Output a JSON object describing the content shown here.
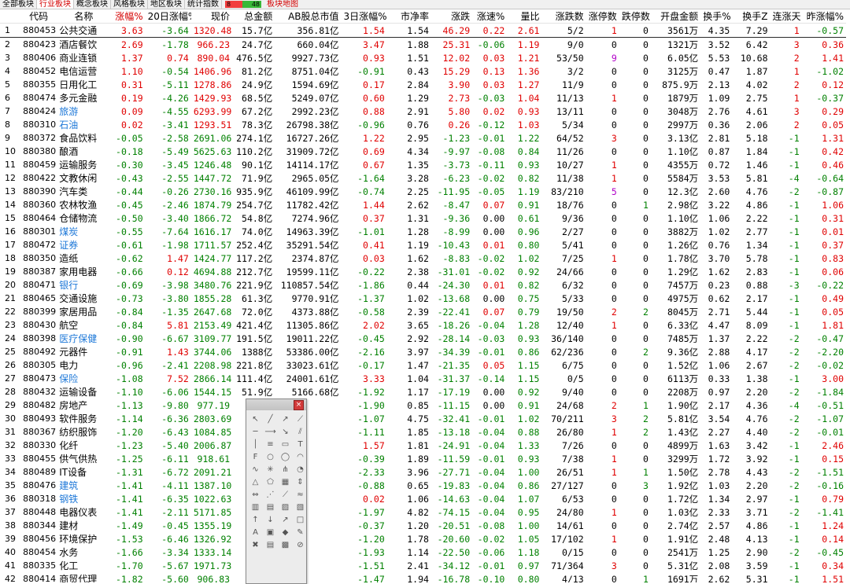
{
  "tabs": [
    {
      "label": "全部板块",
      "active": false
    },
    {
      "label": "行业板块",
      "active": true
    },
    {
      "label": "概念板块",
      "active": false
    },
    {
      "label": "风格板块",
      "active": false
    },
    {
      "label": "地区板块",
      "active": false
    },
    {
      "label": "统计指数",
      "active": false
    }
  ],
  "breadth": {
    "advancing": "8",
    "declining": "48"
  },
  "map_tab_label": "板块地图",
  "columns": [
    "",
    "代码",
    "名称",
    "涨幅%",
    "20日涨幅%",
    "现价",
    "总金额",
    "AB股总市值",
    "3日涨幅%",
    "市净率",
    "涨跌",
    "涨速%",
    "量比",
    "涨跌数",
    "涨停数",
    "跌停数",
    "开盘金额",
    "换手%",
    "换手Z",
    "连涨天",
    "昨涨幅%"
  ],
  "sorted_column": "涨幅%",
  "rows": [
    [
      "1",
      "880453",
      "公共交通",
      "3.63",
      "-3.64",
      "1320.48",
      "15.7亿",
      "356.81亿",
      "1.54",
      "1.54",
      "46.29",
      "0.22",
      "2.61",
      "5/2",
      "1",
      "0",
      "3561万",
      "4.35",
      "7.29",
      "1",
      "-0.57"
    ],
    [
      "2",
      "880423",
      "酒店餐饮",
      "2.69",
      "-1.78",
      "966.23",
      "24.7亿",
      "660.04亿",
      "3.47",
      "1.88",
      "25.31",
      "-0.06",
      "1.19",
      "9/0",
      "0",
      "0",
      "1321万",
      "3.52",
      "6.42",
      "3",
      "0.36"
    ],
    [
      "3",
      "880406",
      "商业连锁",
      "1.37",
      "0.74",
      "890.04",
      "476.5亿",
      "9927.73亿",
      "0.93",
      "1.51",
      "12.02",
      "0.03",
      "1.21",
      "53/50",
      "9",
      "0",
      "6.05亿",
      "5.53",
      "10.68",
      "2",
      "1.41"
    ],
    [
      "4",
      "880452",
      "电信运营",
      "1.10",
      "-0.54",
      "1406.96",
      "81.2亿",
      "8751.04亿",
      "-0.91",
      "0.43",
      "15.29",
      "0.13",
      "1.36",
      "3/2",
      "0",
      "0",
      "3125万",
      "0.47",
      "1.87",
      "1",
      "-1.02"
    ],
    [
      "5",
      "880355",
      "日用化工",
      "0.31",
      "-5.11",
      "1278.86",
      "24.9亿",
      "1594.69亿",
      "0.17",
      "2.84",
      "3.90",
      "0.03",
      "1.27",
      "11/9",
      "0",
      "0",
      "875.9万",
      "2.13",
      "4.02",
      "2",
      "0.12"
    ],
    [
      "6",
      "880474",
      "多元金融",
      "0.19",
      "-4.26",
      "1429.93",
      "68.5亿",
      "5249.07亿",
      "0.60",
      "1.29",
      "2.73",
      "-0.03",
      "1.04",
      "11/13",
      "1",
      "0",
      "1879万",
      "1.09",
      "2.75",
      "1",
      "-0.37"
    ],
    [
      "7",
      "880424",
      "旅游",
      "0.09",
      "-4.55",
      "6293.99",
      "67.2亿",
      "2992.23亿",
      "0.88",
      "2.91",
      "5.80",
      "0.02",
      "0.93",
      "13/11",
      "0",
      "0",
      "3048万",
      "2.76",
      "4.61",
      "3",
      "0.29"
    ],
    [
      "8",
      "880310",
      "石油",
      "0.02",
      "-3.41",
      "1293.51",
      "78.3亿",
      "26798.38亿",
      "-0.96",
      "0.76",
      "0.26",
      "-0.12",
      "1.03",
      "5/34",
      "0",
      "0",
      "2997万",
      "0.36",
      "2.06",
      "2",
      "0.05"
    ],
    [
      "9",
      "880372",
      "食品饮料",
      "-0.05",
      "-2.58",
      "2691.06",
      "274.1亿",
      "16727.26亿",
      "1.22",
      "2.95",
      "-1.23",
      "-0.01",
      "1.22",
      "64/52",
      "3",
      "0",
      "3.13亿",
      "2.81",
      "5.18",
      "-1",
      "1.31"
    ],
    [
      "10",
      "880380",
      "酿酒",
      "-0.18",
      "-5.49",
      "5625.63",
      "110.2亿",
      "31909.72亿",
      "0.69",
      "4.34",
      "-9.97",
      "-0.08",
      "0.84",
      "11/26",
      "0",
      "0",
      "1.10亿",
      "0.87",
      "1.84",
      "-1",
      "0.42"
    ],
    [
      "11",
      "880459",
      "运输服务",
      "-0.30",
      "-3.45",
      "1246.48",
      "90.1亿",
      "14114.17亿",
      "0.67",
      "1.35",
      "-3.73",
      "-0.11",
      "0.93",
      "10/27",
      "1",
      "0",
      "4355万",
      "0.72",
      "1.46",
      "-1",
      "0.46"
    ],
    [
      "12",
      "880422",
      "文教休闲",
      "-0.43",
      "-2.55",
      "1447.72",
      "71.9亿",
      "2965.05亿",
      "-1.64",
      "3.28",
      "-6.23",
      "-0.02",
      "0.82",
      "11/38",
      "1",
      "0",
      "5584万",
      "3.53",
      "5.81",
      "-4",
      "-0.64"
    ],
    [
      "13",
      "880390",
      "汽车类",
      "-0.44",
      "-0.26",
      "2730.16",
      "935.9亿",
      "46109.99亿",
      "-0.74",
      "2.25",
      "-11.95",
      "-0.05",
      "1.19",
      "83/210",
      "5",
      "0",
      "12.3亿",
      "2.60",
      "4.76",
      "-2",
      "-0.87"
    ],
    [
      "14",
      "880360",
      "农林牧渔",
      "-0.45",
      "-2.46",
      "1874.79",
      "254.7亿",
      "11782.42亿",
      "1.44",
      "2.62",
      "-8.47",
      "0.07",
      "0.91",
      "18/76",
      "0",
      "1",
      "2.98亿",
      "3.22",
      "4.86",
      "-1",
      "1.06"
    ],
    [
      "15",
      "880464",
      "仓储物流",
      "-0.50",
      "-3.40",
      "1866.72",
      "54.8亿",
      "7274.96亿",
      "0.37",
      "1.31",
      "-9.36",
      "0.00",
      "0.61",
      "9/36",
      "0",
      "0",
      "1.10亿",
      "1.06",
      "2.22",
      "-1",
      "0.31"
    ],
    [
      "16",
      "880301",
      "煤炭",
      "-0.55",
      "-7.64",
      "1616.17",
      "74.0亿",
      "14963.39亿",
      "-1.01",
      "1.28",
      "-8.99",
      "0.00",
      "0.96",
      "2/27",
      "0",
      "0",
      "3882万",
      "1.02",
      "2.77",
      "-1",
      "0.01"
    ],
    [
      "17",
      "880472",
      "证券",
      "-0.61",
      "-1.98",
      "1711.57",
      "252.4亿",
      "35291.54亿",
      "0.41",
      "1.19",
      "-10.43",
      "0.01",
      "0.80",
      "5/41",
      "0",
      "0",
      "1.26亿",
      "0.76",
      "1.34",
      "-1",
      "0.37"
    ],
    [
      "18",
      "880350",
      "造纸",
      "-0.62",
      "1.47",
      "1424.77",
      "117.2亿",
      "2374.87亿",
      "0.03",
      "1.62",
      "-8.83",
      "-0.02",
      "1.02",
      "7/25",
      "1",
      "0",
      "1.78亿",
      "3.70",
      "5.78",
      "-1",
      "0.83"
    ],
    [
      "19",
      "880387",
      "家用电器",
      "-0.66",
      "0.12",
      "4694.88",
      "212.7亿",
      "19599.11亿",
      "-0.22",
      "2.38",
      "-31.01",
      "-0.02",
      "0.92",
      "24/66",
      "0",
      "0",
      "1.29亿",
      "1.62",
      "2.83",
      "-1",
      "0.06"
    ],
    [
      "20",
      "880471",
      "银行",
      "-0.69",
      "-3.98",
      "3480.76",
      "221.9亿",
      "110857.54亿",
      "-1.86",
      "0.44",
      "-24.30",
      "0.01",
      "0.82",
      "6/32",
      "0",
      "0",
      "7457万",
      "0.23",
      "0.88",
      "-3",
      "-0.22"
    ],
    [
      "21",
      "880465",
      "交通设施",
      "-0.73",
      "-3.80",
      "1855.28",
      "61.3亿",
      "9770.91亿",
      "-1.37",
      "1.02",
      "-13.68",
      "0.00",
      "0.75",
      "5/33",
      "0",
      "0",
      "4975万",
      "0.62",
      "2.17",
      "-1",
      "0.49"
    ],
    [
      "22",
      "880399",
      "家居用品",
      "-0.84",
      "-1.35",
      "2647.68",
      "72.0亿",
      "4373.88亿",
      "-0.58",
      "2.39",
      "-22.41",
      "0.07",
      "0.79",
      "19/50",
      "2",
      "2",
      "8045万",
      "2.71",
      "5.44",
      "-1",
      "0.05"
    ],
    [
      "23",
      "880430",
      "航空",
      "-0.84",
      "5.81",
      "2153.49",
      "421.4亿",
      "11305.86亿",
      "2.02",
      "3.65",
      "-18.26",
      "-0.04",
      "1.28",
      "12/40",
      "1",
      "0",
      "6.33亿",
      "4.47",
      "8.09",
      "-1",
      "1.81"
    ],
    [
      "24",
      "880398",
      "医疗保健",
      "-0.90",
      "-6.67",
      "3109.77",
      "191.5亿",
      "19011.22亿",
      "-0.45",
      "2.92",
      "-28.14",
      "-0.03",
      "0.93",
      "36/140",
      "0",
      "0",
      "7485万",
      "1.37",
      "2.22",
      "-2",
      "-0.47"
    ],
    [
      "25",
      "880492",
      "元器件",
      "-0.91",
      "1.43",
      "3744.06",
      "1388亿",
      "53386.00亿",
      "-2.16",
      "3.97",
      "-34.39",
      "-0.01",
      "0.86",
      "62/236",
      "0",
      "2",
      "9.36亿",
      "2.88",
      "4.17",
      "-2",
      "-2.20"
    ],
    [
      "26",
      "880305",
      "电力",
      "-0.96",
      "-2.41",
      "2208.98",
      "221.8亿",
      "33023.61亿",
      "-0.17",
      "1.47",
      "-21.35",
      "0.05",
      "1.15",
      "6/75",
      "0",
      "0",
      "1.52亿",
      "1.06",
      "2.67",
      "-2",
      "-0.02"
    ],
    [
      "27",
      "880473",
      "保险",
      "-1.08",
      "7.52",
      "2866.14",
      "111.4亿",
      "24001.61亿",
      "3.33",
      "1.04",
      "-31.37",
      "-0.14",
      "1.15",
      "0/5",
      "0",
      "0",
      "6113万",
      "0.33",
      "1.38",
      "-1",
      "3.00"
    ],
    [
      "28",
      "880432",
      "运输设备",
      "-1.10",
      "-6.06",
      "1544.15",
      "51.9亿",
      "5166.68亿",
      "-1.92",
      "1.17",
      "-17.19",
      "0.00",
      "0.92",
      "9/40",
      "0",
      "0",
      "2208万",
      "0.97",
      "2.20",
      "-2",
      "-1.84"
    ],
    [
      "29",
      "880482",
      "房地产",
      "-1.13",
      "-9.80",
      "977.19",
      "",
      "",
      "-1.90",
      "0.85",
      "-11.15",
      "0.00",
      "0.91",
      "24/68",
      "2",
      "1",
      "1.90亿",
      "2.17",
      "4.36",
      "-4",
      "-0.51"
    ],
    [
      "30",
      "880493",
      "软件服务",
      "-1.14",
      "-6.36",
      "2803.69",
      "",
      "",
      "-1.07",
      "4.75",
      "-32.41",
      "-0.01",
      "1.02",
      "70/211",
      "3",
      "2",
      "5.81亿",
      "3.54",
      "4.76",
      "-2",
      "-1.07"
    ],
    [
      "31",
      "880367",
      "纺织服饰",
      "-1.20",
      "-6.43",
      "1084.85",
      "",
      "",
      "-1.11",
      "1.85",
      "-13.18",
      "-0.04",
      "0.88",
      "26/80",
      "1",
      "2",
      "1.43亿",
      "2.27",
      "4.40",
      "-2",
      "-0.01"
    ],
    [
      "32",
      "880330",
      "化纤",
      "-1.23",
      "-5.40",
      "2006.87",
      "",
      "",
      "1.57",
      "1.81",
      "-24.91",
      "-0.04",
      "1.33",
      "7/26",
      "0",
      "0",
      "4899万",
      "1.63",
      "3.42",
      "-1",
      "2.46"
    ],
    [
      "33",
      "880455",
      "供气供热",
      "-1.25",
      "-6.11",
      "918.61",
      "",
      "",
      "-0.39",
      "1.89",
      "-11.59",
      "-0.01",
      "0.93",
      "7/38",
      "1",
      "0",
      "3299万",
      "1.72",
      "3.92",
      "-1",
      "0.15"
    ],
    [
      "34",
      "880489",
      "IT设备",
      "-1.31",
      "-6.72",
      "2091.21",
      "",
      "",
      "-2.33",
      "3.96",
      "-27.71",
      "-0.04",
      "1.00",
      "26/51",
      "1",
      "1",
      "1.50亿",
      "2.78",
      "4.43",
      "-2",
      "-1.51"
    ],
    [
      "35",
      "880476",
      "建筑",
      "-1.41",
      "-4.11",
      "1387.10",
      "",
      "",
      "-0.88",
      "0.65",
      "-19.83",
      "-0.04",
      "0.86",
      "27/127",
      "0",
      "3",
      "1.92亿",
      "1.03",
      "2.20",
      "-2",
      "-0.16"
    ],
    [
      "36",
      "880318",
      "钢铁",
      "-1.41",
      "-6.35",
      "1022.63",
      "",
      "",
      "0.02",
      "1.06",
      "-14.63",
      "-0.04",
      "1.07",
      "6/53",
      "0",
      "0",
      "1.72亿",
      "1.34",
      "2.97",
      "-1",
      "0.79"
    ],
    [
      "37",
      "880448",
      "电器仪表",
      "-1.41",
      "-2.11",
      "5171.85",
      "",
      "",
      "-1.97",
      "4.82",
      "-74.15",
      "-0.04",
      "0.95",
      "24/80",
      "1",
      "0",
      "1.03亿",
      "2.33",
      "3.71",
      "-2",
      "-1.41"
    ],
    [
      "38",
      "880344",
      "建材",
      "-1.49",
      "-0.45",
      "1355.19",
      "",
      "",
      "-0.37",
      "1.20",
      "-20.51",
      "-0.08",
      "1.00",
      "14/61",
      "0",
      "0",
      "2.74亿",
      "2.57",
      "4.86",
      "-1",
      "1.24"
    ],
    [
      "39",
      "880456",
      "环境保护",
      "-1.53",
      "-6.46",
      "1326.92",
      "",
      "",
      "-1.20",
      "1.78",
      "-20.60",
      "-0.02",
      "1.05",
      "17/102",
      "1",
      "0",
      "1.91亿",
      "2.48",
      "4.13",
      "-1",
      "0.14"
    ],
    [
      "40",
      "880454",
      "水务",
      "-1.66",
      "-3.34",
      "1333.14",
      "",
      "",
      "-1.93",
      "1.14",
      "-22.50",
      "-0.06",
      "1.18",
      "0/15",
      "0",
      "0",
      "2541万",
      "1.25",
      "2.90",
      "-2",
      "-0.45"
    ],
    [
      "41",
      "880335",
      "化工",
      "-1.70",
      "-5.67",
      "1971.73",
      "",
      "",
      "-1.51",
      "2.41",
      "-34.12",
      "-0.01",
      "0.97",
      "71/364",
      "3",
      "0",
      "5.31亿",
      "2.08",
      "3.59",
      "-1",
      "0.34"
    ],
    [
      "42",
      "880414",
      "商贸代理",
      "-1.82",
      "-5.60",
      "906.83",
      "",
      "",
      "-1.47",
      "1.94",
      "-16.78",
      "-0.10",
      "0.80",
      "4/13",
      "0",
      "1",
      "1691万",
      "2.62",
      "5.31",
      "-1",
      "1.51"
    ]
  ],
  "highlighted_names": [
    "旅游",
    "石油",
    "煤炭",
    "证券",
    "银行",
    "医疗保健",
    "保险",
    "建筑",
    "钢铁"
  ],
  "colors": {
    "up": "#e00000",
    "down": "#008000",
    "highlight_name": "#1e78d8",
    "limit_up_count": "#b000c8",
    "active_tab": "#d40000"
  },
  "draw_tools": {
    "close_label": "×",
    "icons": [
      "select-arrow-icon",
      "line-icon",
      "ray-icon",
      "segment-icon",
      "horizontal-line-icon",
      "extend-line-icon",
      "arrow-line-icon",
      "parallel-line-icon",
      "vertical-line-icon",
      "channel-icon",
      "rect-icon",
      "text-icon",
      "fib-icon",
      "circle-icon",
      "ellipse-icon",
      "arc-icon",
      "wave-icon",
      "gann-icon",
      "pitchfork-icon",
      "cycle-icon",
      "triangle-icon",
      "polygon-icon",
      "grid-icon",
      "price-range-icon",
      "period-icon",
      "fan-icon",
      "speed-line-icon",
      "regression-icon",
      "bars-icon",
      "volume-bars-icon",
      "histogram-icon",
      "columns-icon",
      "up-arrow-icon",
      "down-arrow-icon",
      "trend-icon",
      "box-icon",
      "label-icon",
      "stamp-icon",
      "marker-icon",
      "note-icon",
      "delete-icon",
      "save-icon",
      "color-icon",
      "lock-icon"
    ],
    "icon_glyphs": [
      "↖",
      "╱",
      "↗",
      "⟋",
      "─",
      "⟶",
      "↘",
      "⫽",
      "│",
      "≡",
      "▭",
      "T",
      "F",
      "○",
      "◯",
      "◠",
      "∿",
      "✳",
      "⋔",
      "◔",
      "△",
      "⬠",
      "▦",
      "⇕",
      "⇔",
      "⋰",
      "⟋",
      "≈",
      "▥",
      "▤",
      "▨",
      "▧",
      "↑",
      "↓",
      "↗",
      "□",
      "A",
      "▣",
      "◆",
      "✎",
      "✖",
      "▤",
      "▩",
      "⊘"
    ]
  }
}
